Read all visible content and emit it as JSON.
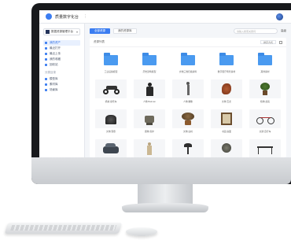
{
  "window": {
    "app_title": "质量数字化台",
    "menu_glyph": "⋮"
  },
  "sidebar": {
    "library_name": "数据资源管理平台",
    "groups": [
      {
        "head": "",
        "items": [
          {
            "label": "我的资产",
            "active": true
          },
          {
            "label": "最近打开",
            "active": false
          },
          {
            "label": "最近上传",
            "active": false
          },
          {
            "label": "我的收藏",
            "active": false
          },
          {
            "label": "回收站",
            "active": false
          }
        ]
      },
      {
        "head": "分类目录",
        "items": [
          {
            "label": "模型库",
            "active": false
          },
          {
            "label": "素材库",
            "active": false
          },
          {
            "label": "场景库",
            "active": false
          }
        ]
      }
    ]
  },
  "toolbar": {
    "tab_active": "全部资源",
    "tab_other": "我的资源库",
    "search_placeholder": "请输入搜索关键词",
    "search_button": "高级"
  },
  "panel": {
    "breadcrumb": "资源列表",
    "sort_label": "排序方式"
  },
  "cards": [
    {
      "caption": "工业设备模型",
      "kind": "folder"
    },
    {
      "caption": "历史建筑模型",
      "kind": "folder"
    },
    {
      "caption": "文物三维扫描资料",
      "kind": "folder"
    },
    {
      "caption": "数字展厅场景素材",
      "kind": "folder"
    },
    {
      "caption": "其他素材",
      "kind": "folder"
    },
    {
      "caption": "机械 摩托车",
      "kind": "motorbike"
    },
    {
      "caption": "人物 Batman",
      "kind": "figure-dark"
    },
    {
      "caption": "人物 雕像",
      "kind": "statue"
    },
    {
      "caption": "文物 玉龙",
      "kind": "dragon"
    },
    {
      "caption": "植物 盆栽",
      "kind": "plant"
    },
    {
      "caption": "文物 铜鼎",
      "kind": "bronze"
    },
    {
      "caption": "器物 香炉",
      "kind": "censer"
    },
    {
      "caption": "文物 古树",
      "kind": "bonsai"
    },
    {
      "caption": "书画 扇面",
      "kind": "frame"
    },
    {
      "caption": "交通 自行车",
      "kind": "bicycle"
    },
    {
      "caption": "汽车",
      "kind": "car"
    },
    {
      "caption": "人物",
      "kind": "figure-light"
    },
    {
      "caption": "灯具",
      "kind": "lamp"
    },
    {
      "caption": "器物",
      "kind": "plate"
    },
    {
      "caption": "桌",
      "kind": "table"
    }
  ]
}
